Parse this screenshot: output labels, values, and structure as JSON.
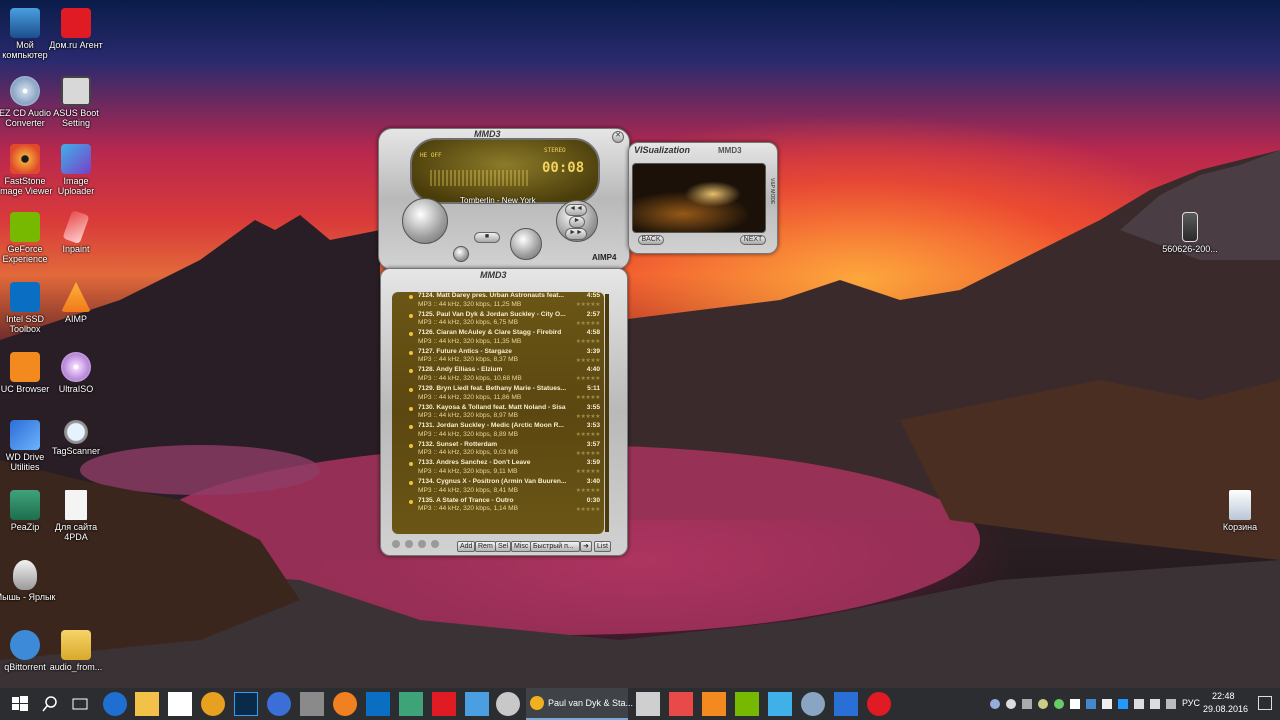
{
  "desktop": {
    "icons_left": [
      {
        "label": "Мой компьютер",
        "icon": "computer-icon"
      },
      {
        "label": "EZ CD Audio Converter",
        "icon": "cd-icon"
      },
      {
        "label": "FastStone Image Viewer",
        "icon": "eye-icon"
      },
      {
        "label": "GeForce Experience",
        "icon": "nvidia-icon"
      },
      {
        "label": "Intel SSD Toolbox",
        "icon": "intel-icon"
      },
      {
        "label": "UC Browser",
        "icon": "uc-browser-icon"
      },
      {
        "label": "WD Drive Utilities",
        "icon": "tools-icon"
      },
      {
        "label": "PeaZip",
        "icon": "archive-icon"
      },
      {
        "label": "Мышь - Ярлык",
        "icon": "mouse-icon"
      },
      {
        "label": "qBittorrent",
        "icon": "qbittorrent-icon"
      }
    ],
    "icons_right_col": [
      {
        "label": "Дом.ru Агент",
        "icon": "domru-icon"
      },
      {
        "label": "ASUS Boot Setting",
        "icon": "bios-icon"
      },
      {
        "label": "Image Uploader",
        "icon": "uploader-icon"
      },
      {
        "label": "Inpaint",
        "icon": "inpaint-icon"
      },
      {
        "label": "AIMP",
        "icon": "aimp-icon"
      },
      {
        "label": "UltraISO",
        "icon": "disc-icon"
      },
      {
        "label": "TagScanner",
        "icon": "magnifier-icon"
      },
      {
        "label": "Для сайта 4PDA",
        "icon": "file-icon"
      },
      {
        "label": "audio_from...",
        "icon": "zip-folder-icon"
      }
    ],
    "file_icon_right": {
      "label": "560626-200...",
      "icon": "image-file-icon"
    },
    "recycle_bin": {
      "label": "Корзина",
      "icon": "recycle-bin-icon"
    }
  },
  "player": {
    "logo": "MMD3",
    "lcd_status_left": "HE OFF",
    "lcd_stereo": "STEREO",
    "lcd_time": "00:08",
    "scroll_title": "Tomberlin - New York",
    "brand": "AIMP4",
    "buttons": {
      "prev": "◄◄",
      "play": "►",
      "next": "►►",
      "stop": "■"
    }
  },
  "visualization": {
    "title": "VISualization",
    "subtitle": "MMD3",
    "back_label": "BACK",
    "next_label": "NEXT",
    "side_label": "V&P MODE"
  },
  "playlist": {
    "logo": "MMD3",
    "items": [
      {
        "title": "7124. Matt Darey pres. Urban Astronauts feat...",
        "duration": "4:55",
        "info": "MP3 :: 44 kHz, 320 kbps, 11,25 MB"
      },
      {
        "title": "7125. Paul Van Dyk & Jordan Suckley - City O...",
        "duration": "2:57",
        "info": "MP3 :: 44 kHz, 320 kbps, 6,75 MB"
      },
      {
        "title": "7126. Ciaran McAuley & Clare Stagg - Firebird",
        "duration": "4:58",
        "info": "MP3 :: 44 kHz, 320 kbps, 11,35 MB"
      },
      {
        "title": "7127. Future Antics - Stargaze",
        "duration": "3:39",
        "info": "MP3 :: 44 kHz, 320 kbps, 8,37 MB"
      },
      {
        "title": "7128. Andy Elliass - Elzium",
        "duration": "4:40",
        "info": "MP3 :: 44 kHz, 320 kbps, 10,68 MB"
      },
      {
        "title": "7129. Bryn Liedl feat. Bethany Marie - Statues...",
        "duration": "5:11",
        "info": "MP3 :: 44 kHz, 320 kbps, 11,86 MB"
      },
      {
        "title": "7130. Kayosa & Tolland feat. Matt Noland - Sisa",
        "duration": "3:55",
        "info": "MP3 :: 44 kHz, 320 kbps, 8,97 MB"
      },
      {
        "title": "7131. Jordan Suckley - Medic (Arctic Moon R...",
        "duration": "3:53",
        "info": "MP3 :: 44 kHz, 320 kbps, 8,89 MB"
      },
      {
        "title": "7132. Sunset - Rotterdam",
        "duration": "3:57",
        "info": "MP3 :: 44 kHz, 320 kbps, 9,03 MB"
      },
      {
        "title": "7133. Andres Sanchez - Don't Leave",
        "duration": "3:59",
        "info": "MP3 :: 44 kHz, 320 kbps, 9,11 MB"
      },
      {
        "title": "7134. Cygnus X - Positron (Armin Van Buuren...",
        "duration": "3:40",
        "info": "MP3 :: 44 kHz, 320 kbps, 8,41 MB"
      },
      {
        "title": "7135. A State of Trance - Outro",
        "duration": "0:30",
        "info": "MP3 :: 44 kHz, 320 kbps, 1,14 MB"
      }
    ],
    "toolbar": {
      "add": "Add",
      "rem": "Rem",
      "sel": "Sel",
      "misc": "Misc",
      "search": "Быстрый п...",
      "list": "List"
    },
    "stars": "★★★★★"
  },
  "taskbar": {
    "active_window": "Paul van Dyk & Sta...",
    "lang": "РУС",
    "time": "22:48",
    "date": "29.08.2016"
  }
}
